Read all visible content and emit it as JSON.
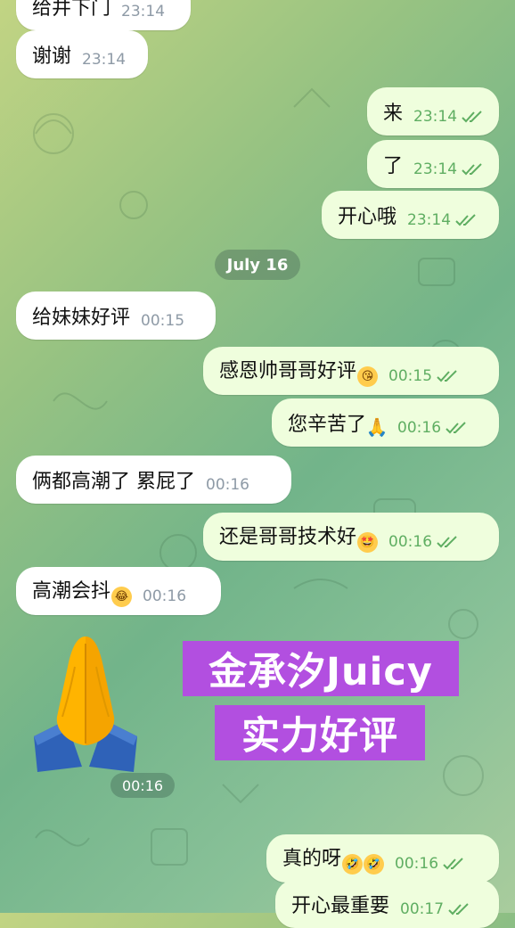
{
  "messages": [
    {
      "text": "给井下门",
      "time": "23:14"
    },
    {
      "text": "谢谢",
      "time": "23:14"
    },
    {
      "text": "来",
      "time": "23:14"
    },
    {
      "text": "了",
      "time": "23:14"
    },
    {
      "text": "开心哦",
      "time": "23:14"
    },
    {
      "text": "给妹妹好评",
      "time": "00:15"
    },
    {
      "text": "感恩帅哥哥好评",
      "time": "00:15",
      "emoji": "kissing-face-emoji"
    },
    {
      "text": "您辛苦了",
      "time": "00:16",
      "emoji": "folded-hands-emoji"
    },
    {
      "text": "俩都高潮了 累屁了",
      "time": "00:16"
    },
    {
      "text": "还是哥哥技术好",
      "time": "00:16",
      "emoji": "star-struck-emoji"
    },
    {
      "text": "高潮会抖",
      "time": "00:16",
      "emoji": "tears-of-joy-emoji"
    },
    {
      "text": "真的呀",
      "time": "00:16",
      "emoji": "rolling-laughing-emoji"
    },
    {
      "text": "开心最重要",
      "time": "00:17"
    }
  ],
  "date_separator": "July 16",
  "sticker": {
    "icon": "folded-hands-sticker",
    "time": "00:16"
  },
  "overlay": {
    "line1": "金承汐Juicy",
    "line2": "实力好评",
    "color": "#b24fe0"
  },
  "colors": {
    "incoming": "#ffffff",
    "outgoing": "#effedd",
    "outgoing_time": "#5fae62",
    "incoming_time": "#8e9aa6"
  }
}
